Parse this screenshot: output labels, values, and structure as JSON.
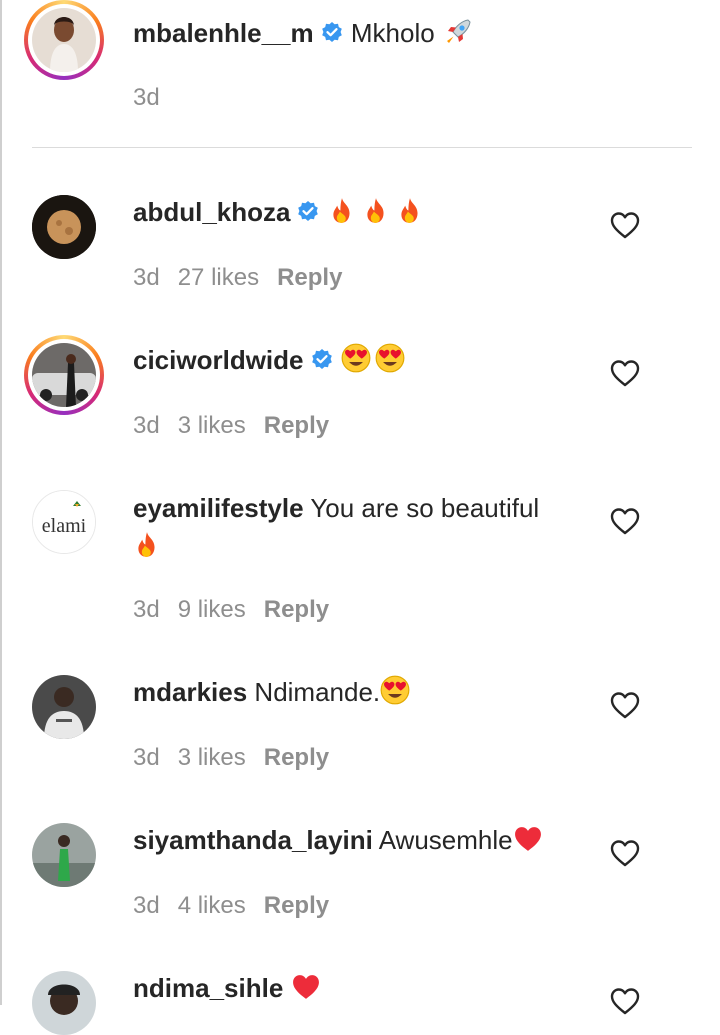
{
  "caption": {
    "username": "mbalenhle__m",
    "text": "Mkholo",
    "time": "3d"
  },
  "comments": [
    {
      "username": "abdul_khoza",
      "text": "",
      "time": "3d",
      "likes": "27 likes",
      "reply": "Reply"
    },
    {
      "username": "ciciworldwide",
      "text": "",
      "time": "3d",
      "likes": "3 likes",
      "reply": "Reply"
    },
    {
      "username": "eyamilifestyle",
      "text": "You are so beautiful",
      "time": "3d",
      "likes": "9 likes",
      "reply": "Reply",
      "avatar_logo": "elami"
    },
    {
      "username": "mdarkies",
      "text": "Ndimande.",
      "time": "3d",
      "likes": "3 likes",
      "reply": "Reply"
    },
    {
      "username": "siyamthanda_layini",
      "text": "Awusemhle",
      "time": "3d",
      "likes": "4 likes",
      "reply": "Reply"
    },
    {
      "username": "ndima_sihle",
      "text": "",
      "time": "",
      "likes": "",
      "reply": ""
    }
  ],
  "icons": {
    "verified": "verified-badge-icon",
    "like": "heart-outline-icon",
    "emoji_rocket": "rocket-emoji",
    "emoji_fire": "fire-emoji",
    "emoji_heart_eyes": "heart-eyes-emoji",
    "emoji_red_heart": "red-heart-emoji"
  },
  "colors": {
    "verified_blue": "#3897f0",
    "text_primary": "#262626",
    "text_secondary": "#8e8e8e",
    "heart_red": "#ed2c3a"
  }
}
